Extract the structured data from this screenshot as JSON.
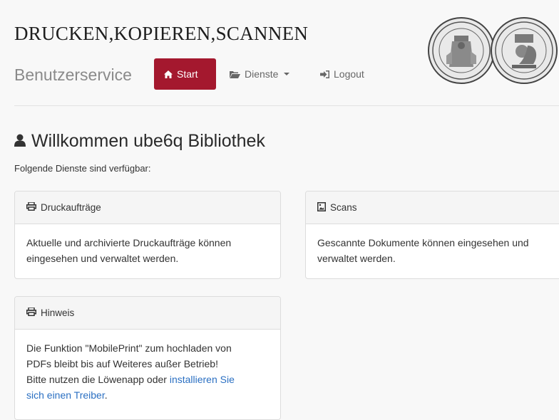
{
  "header": {
    "title": "DRUCKEN,KOPIEREN,SCANNEN",
    "subtitle": "Benutzerservice",
    "nav": {
      "start": {
        "label": "Start",
        "icon": "home-icon"
      },
      "dienste": {
        "label": "Dienste",
        "icon": "folder-open-icon"
      },
      "logout": {
        "label": "Logout",
        "icon": "sign-out-icon"
      }
    }
  },
  "colors": {
    "accent": "#a4182e",
    "link": "#2a6fc2",
    "panel_header_bg": "#f5f5f5"
  },
  "main": {
    "welcome": "Willkommen ube6q Bibliothek",
    "welcome_icon": "user-icon",
    "intro": "Folgende Dienste sind verfügbar:",
    "panels": [
      {
        "title": "Druckaufträge",
        "icon": "print-icon",
        "line1": "Aktuelle und archivierte Druckaufträge können",
        "line2": "eingesehen und verwaltet werden."
      },
      {
        "title": "Scans",
        "icon": "image-file-icon",
        "line1": "Gescannte Dokumente können eingesehen und",
        "line2": "verwaltet werden."
      },
      {
        "title": "Hinweis",
        "icon": "print-icon",
        "line1": "Die Funktion \"MobilePrint\" zum hochladen von",
        "line2": "PDFs bleibt bis auf Weiteres außer Betrieb!",
        "line3": "Bitte nutzen die Löwenapp oder",
        "link_a": "installieren Sie",
        "link_b": "sich einen Treiber",
        "after_link": "."
      }
    ]
  }
}
